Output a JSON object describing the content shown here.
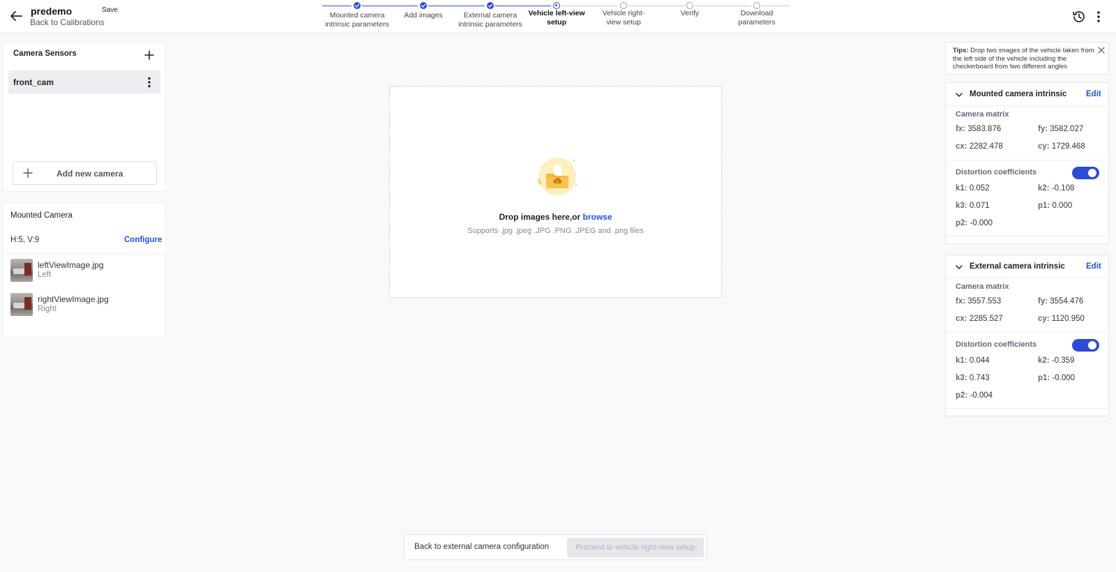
{
  "header": {
    "project_name": "predemo",
    "save_label": "Save",
    "back_link": "Back to Calibrations"
  },
  "stepper": {
    "steps": [
      {
        "label": "Mounted camera intrinsic parameters",
        "state": "done"
      },
      {
        "label": "Add images",
        "state": "done"
      },
      {
        "label": "External camera intrinsic parameters",
        "state": "done"
      },
      {
        "label": "Vehicle left-view setup",
        "state": "current"
      },
      {
        "label": "Vehicle right-view setup",
        "state": "pending"
      },
      {
        "label": "Verify",
        "state": "pending"
      },
      {
        "label": "Download parameters",
        "state": "pending"
      }
    ]
  },
  "sensors": {
    "title": "Camera Sensors",
    "cameras": [
      "front_cam"
    ],
    "add_label": "Add new camera"
  },
  "mounted": {
    "title": "Mounted Camera",
    "hv": "H:5, V:9",
    "configure_label": "Configure",
    "images": [
      {
        "name": "leftViewImage.jpg",
        "side": "Left"
      },
      {
        "name": "rightViewImage.jpg",
        "side": "Right"
      }
    ]
  },
  "dropzone": {
    "drop_text": "Drop images here,or ",
    "browse_label": "browse",
    "supports": "Supports .jpg .jpeg .JPG .PNG .JPEG and .png files"
  },
  "tips": {
    "prefix": "Tips:",
    "text": " Drop two images of the vehicle taken from the left side of the vehicle including the checkerboard from two different angles"
  },
  "mounted_intrinsic": {
    "title": "Mounted camera intrinsic",
    "edit_label": "Edit",
    "matrix_label": "Camera matrix",
    "fx": "3583.876",
    "fy": "3582.027",
    "cx": "2282.478",
    "cy": "1729.468",
    "distortion_label": "Distortion coefficients",
    "distortion_enabled": true,
    "k1": "0.052",
    "k2": "-0.108",
    "k3": "0.071",
    "p1": "0.000",
    "p2": "-0.000"
  },
  "external_intrinsic": {
    "title": "External camera intrinsic",
    "edit_label": "Edit",
    "matrix_label": "Camera matrix",
    "fx": "3557.553",
    "fy": "3554.476",
    "cx": "2285.527",
    "cy": "1120.950",
    "distortion_label": "Distortion coefficients",
    "distortion_enabled": true,
    "k1": "0.044",
    "k2": "-0.359",
    "k3": "0.743",
    "p1": "-0.000",
    "p2": "-0.004"
  },
  "keys": {
    "fx": "fx:",
    "fy": "fy:",
    "cx": "cx:",
    "cy": "cy:",
    "k1": "k1:",
    "k2": "k2:",
    "k3": "k3:",
    "p1": "p1:",
    "p2": "p2:"
  },
  "footer": {
    "back_label": "Back to external camera configuration",
    "proceed_label": "Proceed to vehicle right-view setup"
  },
  "colors": {
    "accent": "#2c4bd6",
    "link": "#1a56db",
    "background": "#f8f9fb"
  },
  "icons": {
    "back": "arrow-left-icon",
    "history": "history-icon",
    "menu": "kebab-icon",
    "add": "plus-icon",
    "collapse": "chevron-down-icon",
    "close": "close-icon",
    "upload": "folder-upload-icon"
  }
}
